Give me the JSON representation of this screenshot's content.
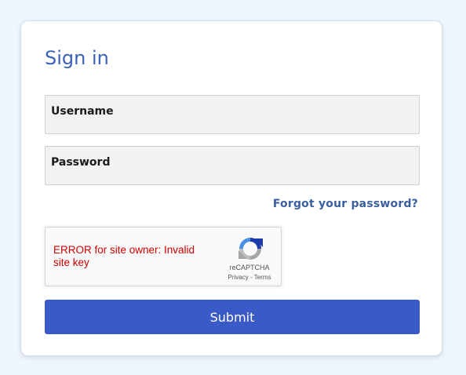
{
  "signin": {
    "title": "Sign in",
    "username_placeholder": "Username",
    "password_placeholder": "Password",
    "forgot_link": "Forgot your password?",
    "submit_label": "Submit"
  },
  "recaptcha": {
    "error_text": "ERROR for site owner: Invalid site key",
    "brand": "reCAPTCHA",
    "links": "Privacy - Terms",
    "icon": "recaptcha-logo-icon"
  },
  "colors": {
    "page_background": "#eef6fd",
    "title": "#3a62b7",
    "link": "#3a5f9f",
    "error": "#d00000",
    "button": "#3a5bc7"
  }
}
